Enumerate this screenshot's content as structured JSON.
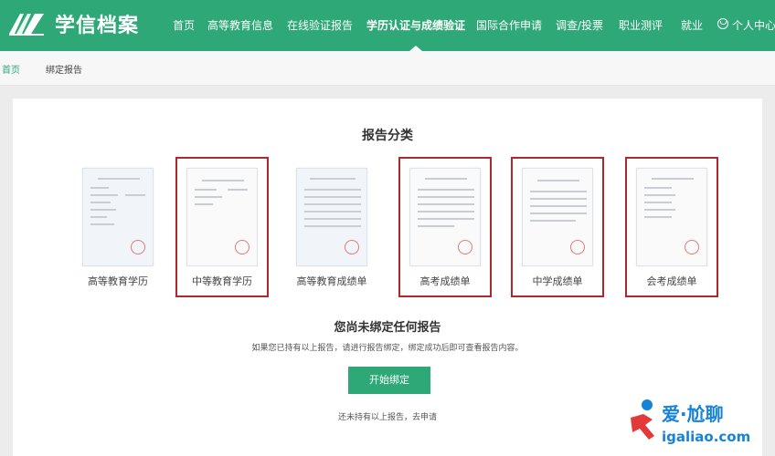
{
  "header": {
    "logo_text": "学信档案",
    "nav": [
      "首页",
      "高等教育信息",
      "在线验证报告",
      "学历认证与成绩验证",
      "国际合作申请",
      "调查/投票",
      "职业测评",
      "就业",
      "个人中心"
    ]
  },
  "breadcrumb": {
    "home": "首页",
    "current": "绑定报告"
  },
  "section_title": "报告分类",
  "reports": [
    {
      "label": "高等教育学历",
      "highlighted": false
    },
    {
      "label": "中等教育学历",
      "highlighted": true
    },
    {
      "label": "高等教育成绩单",
      "highlighted": false
    },
    {
      "label": "高考成绩单",
      "highlighted": true
    },
    {
      "label": "中学成绩单",
      "highlighted": true
    },
    {
      "label": "会考成绩单",
      "highlighted": true
    }
  ],
  "empty_state": {
    "title": "您尚未绑定任何报告",
    "description": "如果您已持有以上报告，请进行报告绑定，绑定成功后即可查看报告内容。",
    "button": "开始绑定",
    "apply_text": "还未持有以上报告，去申请"
  },
  "watermark": {
    "text": "爱·尬聊",
    "url": "igaliao.com"
  },
  "colors": {
    "brand": "#2fa878",
    "highlight": "#b0272d",
    "watermark": "#1683d8"
  }
}
